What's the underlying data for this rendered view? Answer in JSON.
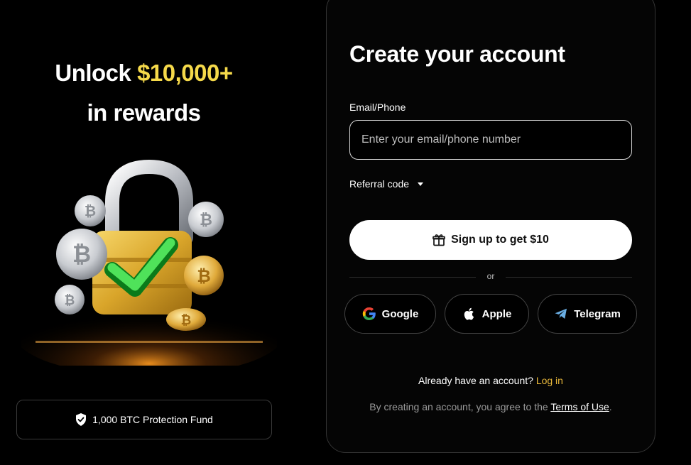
{
  "promo": {
    "line1_prefix": "Unlock ",
    "line1_highlight": "$10,000+",
    "line2": "in rewards",
    "highlight_color": "#f5d94a",
    "protection_text": "1,000 BTC Protection Fund",
    "protection_icon": "shield-check-icon"
  },
  "form": {
    "title": "Create your account",
    "email_label": "Email/Phone",
    "email_placeholder": "Enter your email/phone number",
    "email_value": "",
    "referral_label": "Referral code",
    "signup_label": "Sign up to get $10",
    "divider_text": "or",
    "social": [
      {
        "label": "Google",
        "icon": "google-icon"
      },
      {
        "label": "Apple",
        "icon": "apple-icon"
      },
      {
        "label": "Telegram",
        "icon": "telegram-icon"
      }
    ],
    "login_prompt": "Already have an account?",
    "login_link": "Log in",
    "terms_prefix": "By creating an account, you agree to the",
    "terms_link": "Terms of Use",
    "terms_suffix": ".",
    "accent_color": "#e5b53a"
  }
}
